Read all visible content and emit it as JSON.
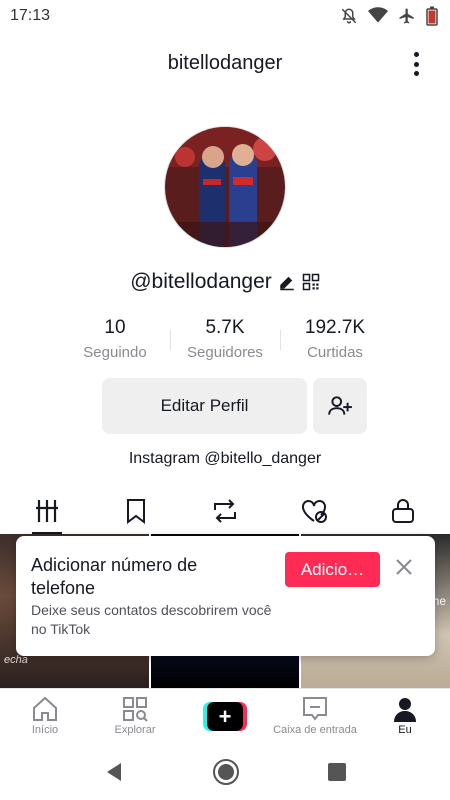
{
  "status_bar": {
    "time": "17:13"
  },
  "header": {
    "title": "bitellodanger"
  },
  "profile": {
    "handle": "@bitellodanger",
    "stats": [
      {
        "value": "10",
        "label": "Seguindo"
      },
      {
        "value": "5.7K",
        "label": "Seguidores"
      },
      {
        "value": "192.7K",
        "label": "Curtidas"
      }
    ],
    "edit_label": "Editar Perfil",
    "bio": "Instagram @bitello_danger"
  },
  "tabs": [
    {
      "icon": "videos-grid-icon",
      "active": true
    },
    {
      "icon": "bookmark-icon",
      "active": false
    },
    {
      "icon": "repost-icon",
      "active": false
    },
    {
      "icon": "liked-hidden-icon",
      "active": false
    },
    {
      "icon": "lock-icon",
      "active": false
    }
  ],
  "thumbnails": {
    "t1_text": "echa",
    "t3_text": "he"
  },
  "banner": {
    "title": "Adicionar número de telefone",
    "subtitle": "Deixe seus contatos descobrirem você no TikTok",
    "cta": "Adicio…"
  },
  "bottom_nav": [
    {
      "label": "Início"
    },
    {
      "label": "Explorar"
    },
    {
      "label": ""
    },
    {
      "label": "Caixa de entrada"
    },
    {
      "label": "Eu"
    }
  ],
  "colors": {
    "accent": "#fe2c55",
    "cyan": "#25f4ee",
    "text": "#161823",
    "muted": "#8a8b91"
  }
}
